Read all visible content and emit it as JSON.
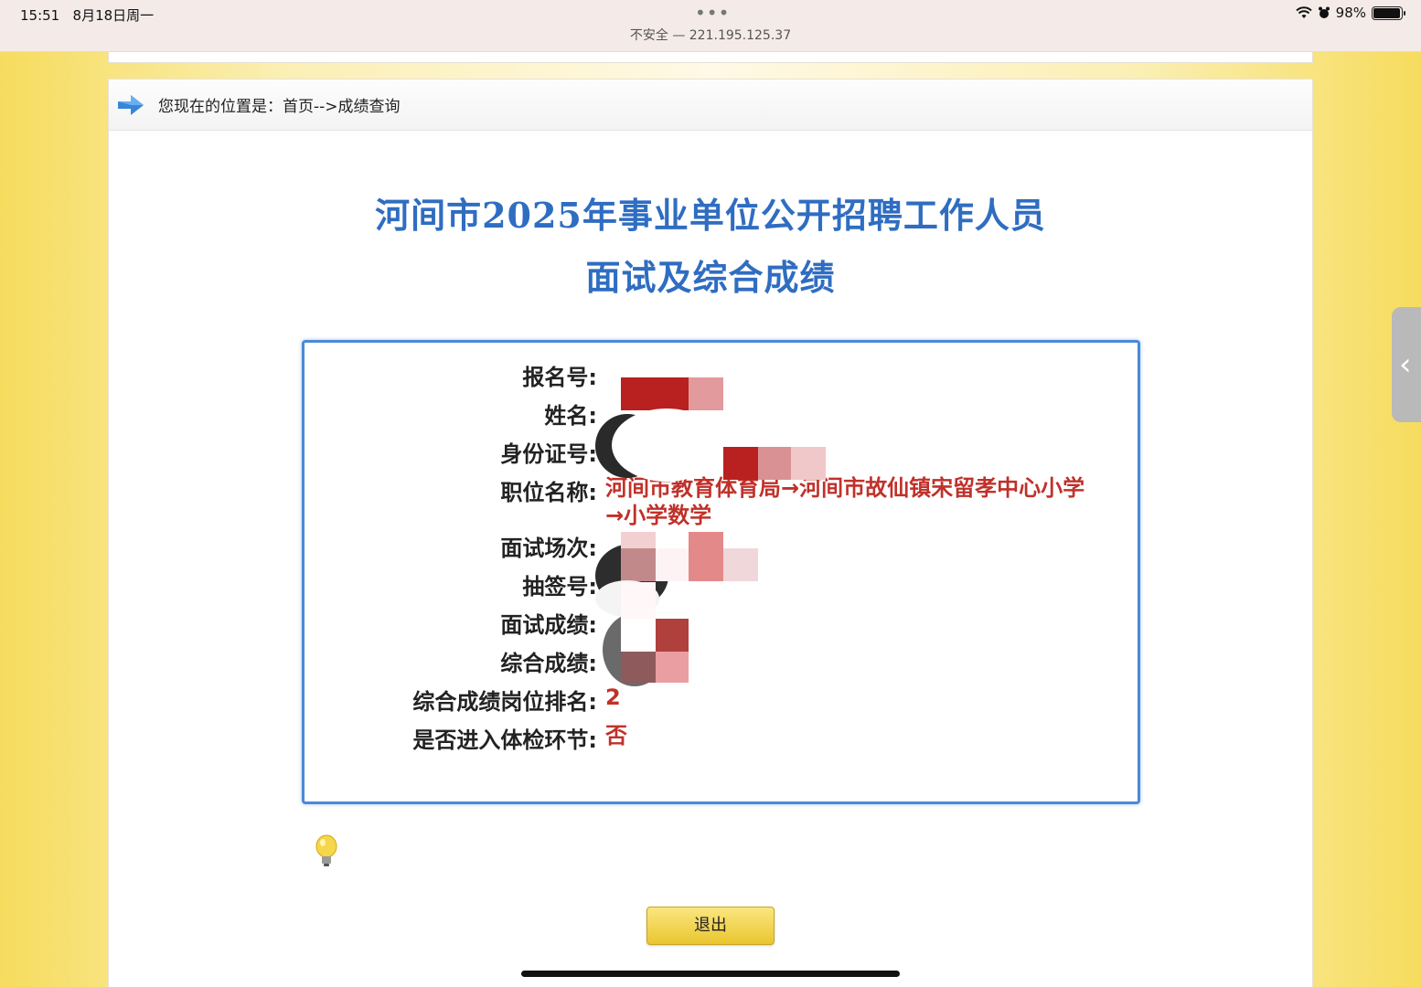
{
  "status_bar": {
    "time": "15:51",
    "date": "8月18日周一",
    "dots": "•••",
    "url": "不安全 — 221.195.125.37",
    "battery": "98%",
    "battery_level": 0.98
  },
  "breadcrumb": {
    "text": "您现在的位置是：首页-->成绩查询"
  },
  "page": {
    "title_line1": "河间市2025年事业单位公开招聘工作人员",
    "title_line2": "面试及综合成绩"
  },
  "result": {
    "fields": [
      {
        "label": "报名号:",
        "value": ""
      },
      {
        "label": "姓名:",
        "value": ""
      },
      {
        "label": "身份证号:",
        "value": ""
      },
      {
        "label": "职位名称:",
        "value": "河间市教育体育局→河间市故仙镇宋留孝中心小学→小学数学"
      },
      {
        "label": "面试场次:",
        "value": ""
      },
      {
        "label": "抽签号:",
        "value": ""
      },
      {
        "label": "面试成绩:",
        "value": ""
      },
      {
        "label": "综合成绩:",
        "value": ""
      },
      {
        "label": "综合成绩岗位排名:",
        "value": "2"
      },
      {
        "label": "是否进入体检环节:",
        "value": "否"
      }
    ]
  },
  "buttons": {
    "exit_label": "退出"
  },
  "colors": {
    "title_blue": "#2f6dc1",
    "value_red": "#c0312a",
    "box_border": "#4a8ad6"
  }
}
